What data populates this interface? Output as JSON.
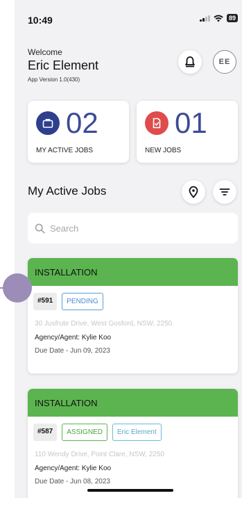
{
  "status": {
    "time": "10:49",
    "battery": "89"
  },
  "header": {
    "welcome": "Welcome",
    "user_name": "Eric Element",
    "app_version": "App Version 1.0(430)",
    "avatar_initials": "EE"
  },
  "stats": [
    {
      "count": "02",
      "label": "MY ACTIVE JOBS",
      "color": "#2e3f8f"
    },
    {
      "count": "01",
      "label": "NEW JOBS",
      "color": "#e04b4b"
    }
  ],
  "section": {
    "title": "My Active Jobs"
  },
  "search": {
    "placeholder": "Search"
  },
  "jobs": [
    {
      "type": "INSTALLATION",
      "id": "#591",
      "status": "PENDING",
      "assignee": "",
      "address": "30 Jusfrute Drive, West Gosford, NSW, 2250",
      "agent": "Agency/Agent: Kylie Koo",
      "due": "Due Date - Jun 09, 2023"
    },
    {
      "type": "INSTALLATION",
      "id": "#587",
      "status": "ASSIGNED",
      "assignee": "Eric Element",
      "address": "110 Wendy Drive, Point Clare, NSW, 2250",
      "agent": "Agency/Agent: Kylie Koo",
      "due": "Due Date - Jun 08, 2023"
    }
  ],
  "colors": {
    "accent": "#3c4b97",
    "card_header": "#5cb450",
    "background": "#f2f2f4"
  }
}
